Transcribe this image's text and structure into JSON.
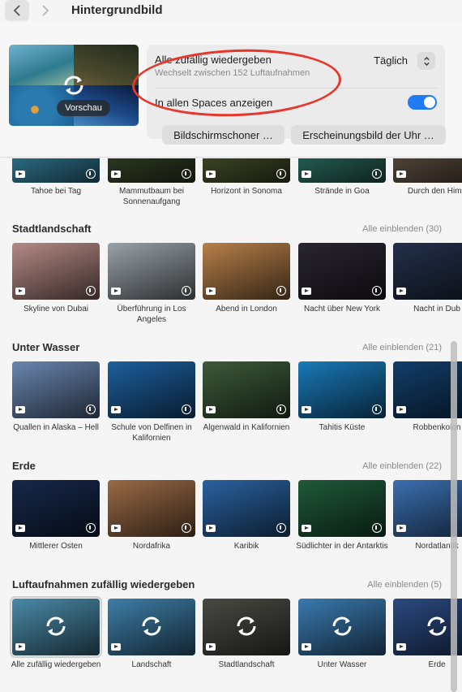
{
  "window": {
    "title": "Hintergrundbild"
  },
  "preview": {
    "label": "Vorschau"
  },
  "shuffle": {
    "title": "Alle zufällig wiedergeben",
    "subtitle": "Wechselt zwischen 152 Luftaufnahmen",
    "frequency": "Täglich",
    "spaces_label": "In allen Spaces anzeigen",
    "spaces_on": true
  },
  "buttons": {
    "screensaver": "Bildschirmschoner …",
    "clock": "Erscheinungsbild der Uhr …"
  },
  "colors": {
    "accent": "#1f7cf4",
    "annotation": "#e8362a"
  },
  "top_row": {
    "items": [
      {
        "caption": "Tahoe bei Tag",
        "swatch": "#3a8fae"
      },
      {
        "caption": "Mammutbaum bei Sonnenaufgang",
        "swatch": "#3b4a2c"
      },
      {
        "caption": "Horizont in Sonoma",
        "swatch": "#4f5a30"
      },
      {
        "caption": "Strände in Goa",
        "swatch": "#2f7a6a"
      },
      {
        "caption": "Durch den Hima",
        "swatch": "#6b5a4a"
      }
    ]
  },
  "sections": [
    {
      "title": "Stadtlandschaft",
      "show_all": "Alle einblenden (30)",
      "items": [
        {
          "caption": "Skyline von Dubai",
          "swatch": "#b58a86"
        },
        {
          "caption": "Überführung in Los Angeles",
          "swatch": "#9aa2a8"
        },
        {
          "caption": "Abend in London",
          "swatch": "#b7804a"
        },
        {
          "caption": "Nacht über New York",
          "swatch": "#2a2530"
        },
        {
          "caption": "Nacht in Dub",
          "swatch": "#24304a"
        }
      ]
    },
    {
      "title": "Unter Wasser",
      "show_all": "Alle einblenden (21)",
      "items": [
        {
          "caption": "Quallen in Alaska – Hell",
          "swatch": "#6a86b0"
        },
        {
          "caption": "Schule von Delfinen in Kalifornien",
          "swatch": "#1d5f9e"
        },
        {
          "caption": "Algenwald in Kalifornien",
          "swatch": "#3d5a3a"
        },
        {
          "caption": "Tahitis Küste",
          "swatch": "#1a79b8"
        },
        {
          "caption": "Robbenkolon",
          "swatch": "#123e6a"
        }
      ]
    },
    {
      "title": "Erde",
      "show_all": "Alle einblenden (22)",
      "items": [
        {
          "caption": "Mittlerer Osten",
          "swatch": "#16284a"
        },
        {
          "caption": "Nordafrika",
          "swatch": "#9a6a46"
        },
        {
          "caption": "Karibik",
          "swatch": "#2a62a0"
        },
        {
          "caption": "Südlichter in der Antarktis",
          "swatch": "#1f5a3a"
        },
        {
          "caption": "Nordatlantik",
          "swatch": "#3b6fb0"
        }
      ]
    },
    {
      "title": "Luftaufnahmen zufällig wiedergeben",
      "show_all": "Alle einblenden (5)",
      "items": [
        {
          "caption": "Alle zufällig wiedergeben",
          "swatch": "#4a8aa8"
        },
        {
          "caption": "Landschaft",
          "swatch": "#3e7ea8"
        },
        {
          "caption": "Stadtlandschaft",
          "swatch": "#4a4a44"
        },
        {
          "caption": "Unter Wasser",
          "swatch": "#3a7ab0"
        },
        {
          "caption": "Erde",
          "swatch": "#2a4a80"
        }
      ]
    }
  ]
}
